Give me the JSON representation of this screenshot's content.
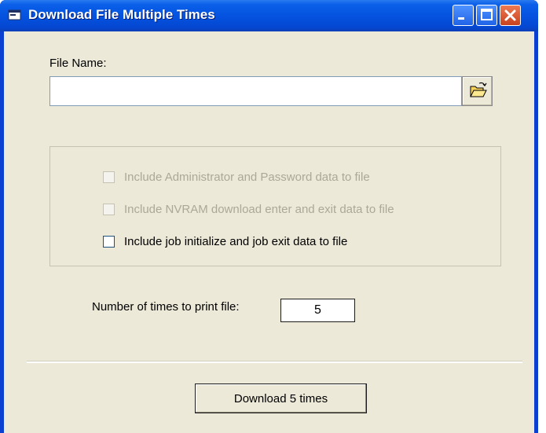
{
  "window": {
    "title": "Download File Multiple Times",
    "icon": "app-window-icon",
    "controls": {
      "minimize": "minimize-icon",
      "maximize": "maximize-icon",
      "close": "close-icon"
    }
  },
  "file": {
    "label": "File Name:",
    "value": "",
    "browse_icon": "open-folder-icon"
  },
  "options": [
    {
      "label": "Include Administrator and Password data to file",
      "checked": false,
      "enabled": false
    },
    {
      "label": "Include NVRAM download enter and exit data to file",
      "checked": false,
      "enabled": false
    },
    {
      "label": "Include job initialize and job exit data to file",
      "checked": false,
      "enabled": true
    }
  ],
  "count": {
    "label": "Number of times to print file:",
    "value": "5"
  },
  "actions": {
    "download_label": "Download 5 times"
  },
  "colors": {
    "titlebar": "#0553e0",
    "dialog_background": "#ece9d8",
    "disabled_text": "#aca899",
    "close_button": "#c8421e"
  }
}
